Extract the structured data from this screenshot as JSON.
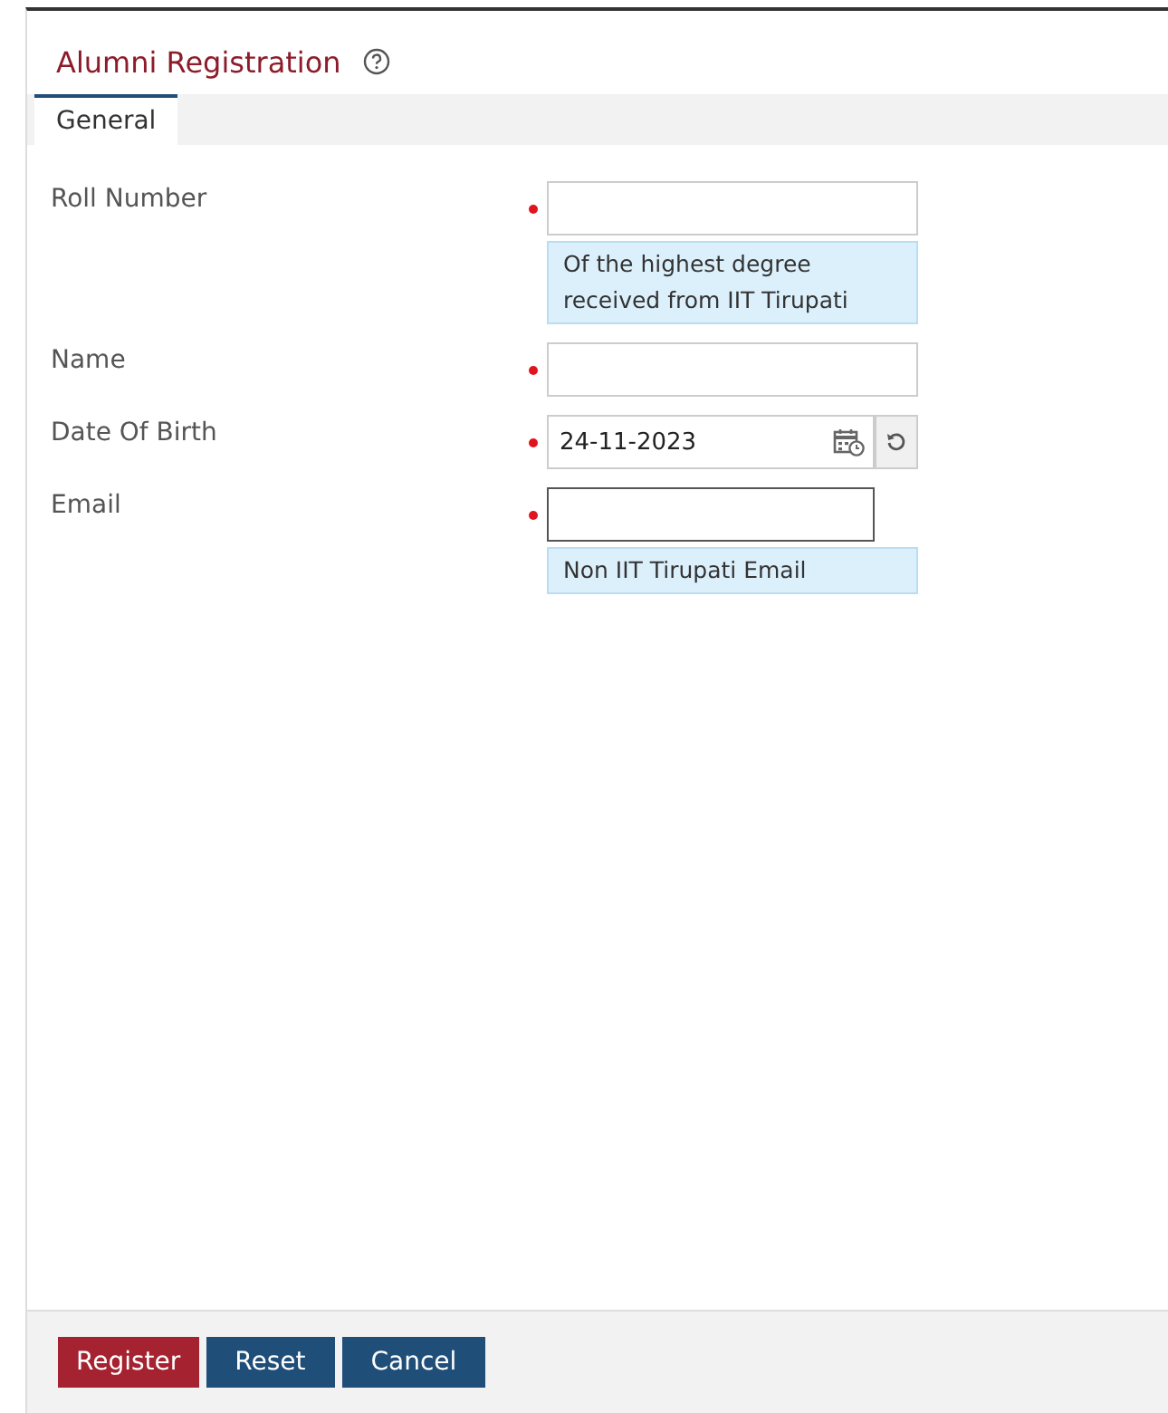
{
  "title": "Alumni Registration",
  "tabs": [
    {
      "label": "General",
      "selected": true
    }
  ],
  "fields": [
    {
      "label": "Roll Number",
      "kind": "text",
      "required": true,
      "hint": "Of the highest degree received from IIT Tirupati"
    },
    {
      "label": "Name",
      "kind": "text",
      "required": true
    },
    {
      "label": "Date Of Birth",
      "kind": "date",
      "required": true,
      "value": "24-11-2023"
    },
    {
      "label": "Email",
      "kind": "text",
      "required": true,
      "focused": true,
      "hint": "Non IIT Tirupati Email"
    }
  ],
  "buttons": [
    {
      "label": "Register",
      "kind": "primary"
    },
    {
      "label": "Reset",
      "kind": "secondary"
    },
    {
      "label": "Cancel",
      "kind": "secondary"
    }
  ]
}
